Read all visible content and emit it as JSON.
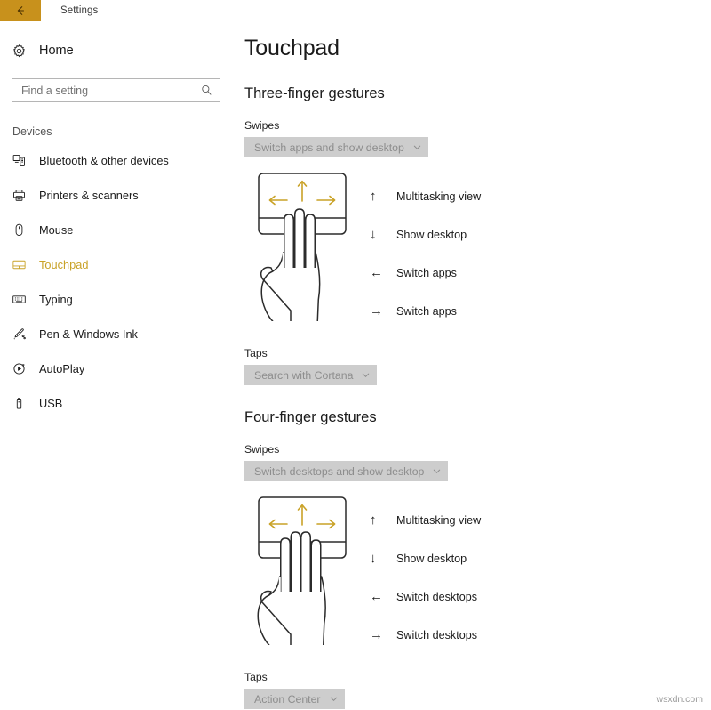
{
  "titlebar": {
    "back_icon": "back-arrow-icon",
    "title": "Settings",
    "accent_color": "#c8911c"
  },
  "sidebar": {
    "home": {
      "label": "Home",
      "icon": "gear-icon"
    },
    "search": {
      "placeholder": "Find a setting",
      "value": "",
      "icon": "search-icon"
    },
    "group_title": "Devices",
    "accent_color": "#c9a227",
    "items": [
      {
        "label": "Bluetooth & other devices",
        "icon": "bluetooth-devices-icon",
        "active": false
      },
      {
        "label": "Printers & scanners",
        "icon": "printer-icon",
        "active": false
      },
      {
        "label": "Mouse",
        "icon": "mouse-icon",
        "active": false
      },
      {
        "label": "Touchpad",
        "icon": "touchpad-icon",
        "active": true
      },
      {
        "label": "Typing",
        "icon": "keyboard-icon",
        "active": false
      },
      {
        "label": "Pen & Windows Ink",
        "icon": "pen-icon",
        "active": false
      },
      {
        "label": "AutoPlay",
        "icon": "autoplay-icon",
        "active": false
      },
      {
        "label": "USB",
        "icon": "usb-icon",
        "active": false
      }
    ]
  },
  "main": {
    "page_title": "Touchpad",
    "sections": [
      {
        "heading": "Three-finger gestures",
        "swipes_label": "Swipes",
        "swipes_value": "Switch apps and show desktop",
        "fingers": 3,
        "gestures": [
          {
            "arrow": "up-arrow-icon",
            "glyph": "↑",
            "label": "Multitasking view"
          },
          {
            "arrow": "down-arrow-icon",
            "glyph": "↓",
            "label": "Show desktop"
          },
          {
            "arrow": "left-arrow-icon",
            "glyph": "←",
            "label": "Switch apps"
          },
          {
            "arrow": "right-arrow-icon",
            "glyph": "→",
            "label": "Switch apps"
          }
        ],
        "taps_label": "Taps",
        "taps_value": "Search with Cortana"
      },
      {
        "heading": "Four-finger gestures",
        "swipes_label": "Swipes",
        "swipes_value": "Switch desktops and show desktop",
        "fingers": 4,
        "gestures": [
          {
            "arrow": "up-arrow-icon",
            "glyph": "↑",
            "label": "Multitasking view"
          },
          {
            "arrow": "down-arrow-icon",
            "glyph": "↓",
            "label": "Show desktop"
          },
          {
            "arrow": "left-arrow-icon",
            "glyph": "←",
            "label": "Switch desktops"
          },
          {
            "arrow": "right-arrow-icon",
            "glyph": "→",
            "label": "Switch desktops"
          }
        ],
        "taps_label": "Taps",
        "taps_value": "Action Center"
      }
    ]
  },
  "watermark": "wsxdn.com"
}
